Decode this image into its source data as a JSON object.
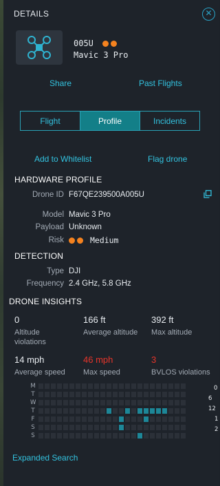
{
  "header": {
    "title": "DETAILS",
    "close_glyph": "✕"
  },
  "device": {
    "id": "005U",
    "model": "Mavic 3 Pro",
    "icon": "drone-icon",
    "risk_dots": 2
  },
  "actions": {
    "share": "Share",
    "past_flights": "Past Flights"
  },
  "tabs": [
    {
      "label": "Flight",
      "active": false
    },
    {
      "label": "Profile",
      "active": true
    },
    {
      "label": "Incidents",
      "active": false
    }
  ],
  "profile_actions": {
    "whitelist": "Add to Whitelist",
    "flag": "Flag drone"
  },
  "hardware": {
    "heading": "HARDWARE PROFILE",
    "drone_id_label": "Drone ID",
    "drone_id": "F67QE239500A005U",
    "model_label": "Model",
    "model": "Mavic 3 Pro",
    "payload_label": "Payload",
    "payload": "Unknown",
    "risk_label": "Risk",
    "risk": "Medium"
  },
  "detection": {
    "heading": "DETECTION",
    "type_label": "Type",
    "type": "DJI",
    "frequency_label": "Frequency",
    "frequency": "2.4 GHz, 5.8 GHz"
  },
  "insights": {
    "heading": "DRONE INSIGHTS",
    "stats": [
      {
        "value": "0",
        "label": "Altitude violations",
        "alert": false
      },
      {
        "value": "166 ft",
        "label": "Average altitude",
        "alert": false
      },
      {
        "value": "392 ft",
        "label": "Max altitude",
        "alert": false
      },
      {
        "value": "14 mph",
        "label": "Average speed",
        "alert": false
      },
      {
        "value": "46 mph",
        "label": "Max speed",
        "alert": true
      },
      {
        "value": "3",
        "label": "BVLOS violations",
        "alert": true
      }
    ]
  },
  "heatmap": {
    "days": [
      "M",
      "T",
      "W",
      "T",
      "F",
      "S",
      "S"
    ],
    "hour_labels": [
      "0",
      "6",
      "12",
      "1",
      "2"
    ],
    "columns": 24,
    "active_cells": [
      [
        3,
        11
      ],
      [
        3,
        14
      ],
      [
        3,
        16
      ],
      [
        3,
        17
      ],
      [
        3,
        18
      ],
      [
        3,
        19
      ],
      [
        3,
        20
      ],
      [
        4,
        13
      ],
      [
        4,
        17
      ],
      [
        5,
        13
      ],
      [
        6,
        16
      ]
    ],
    "colors": {
      "empty": "#2b3038",
      "active": "#1d8798"
    }
  },
  "footer": {
    "expanded_search": "Expanded Search"
  }
}
